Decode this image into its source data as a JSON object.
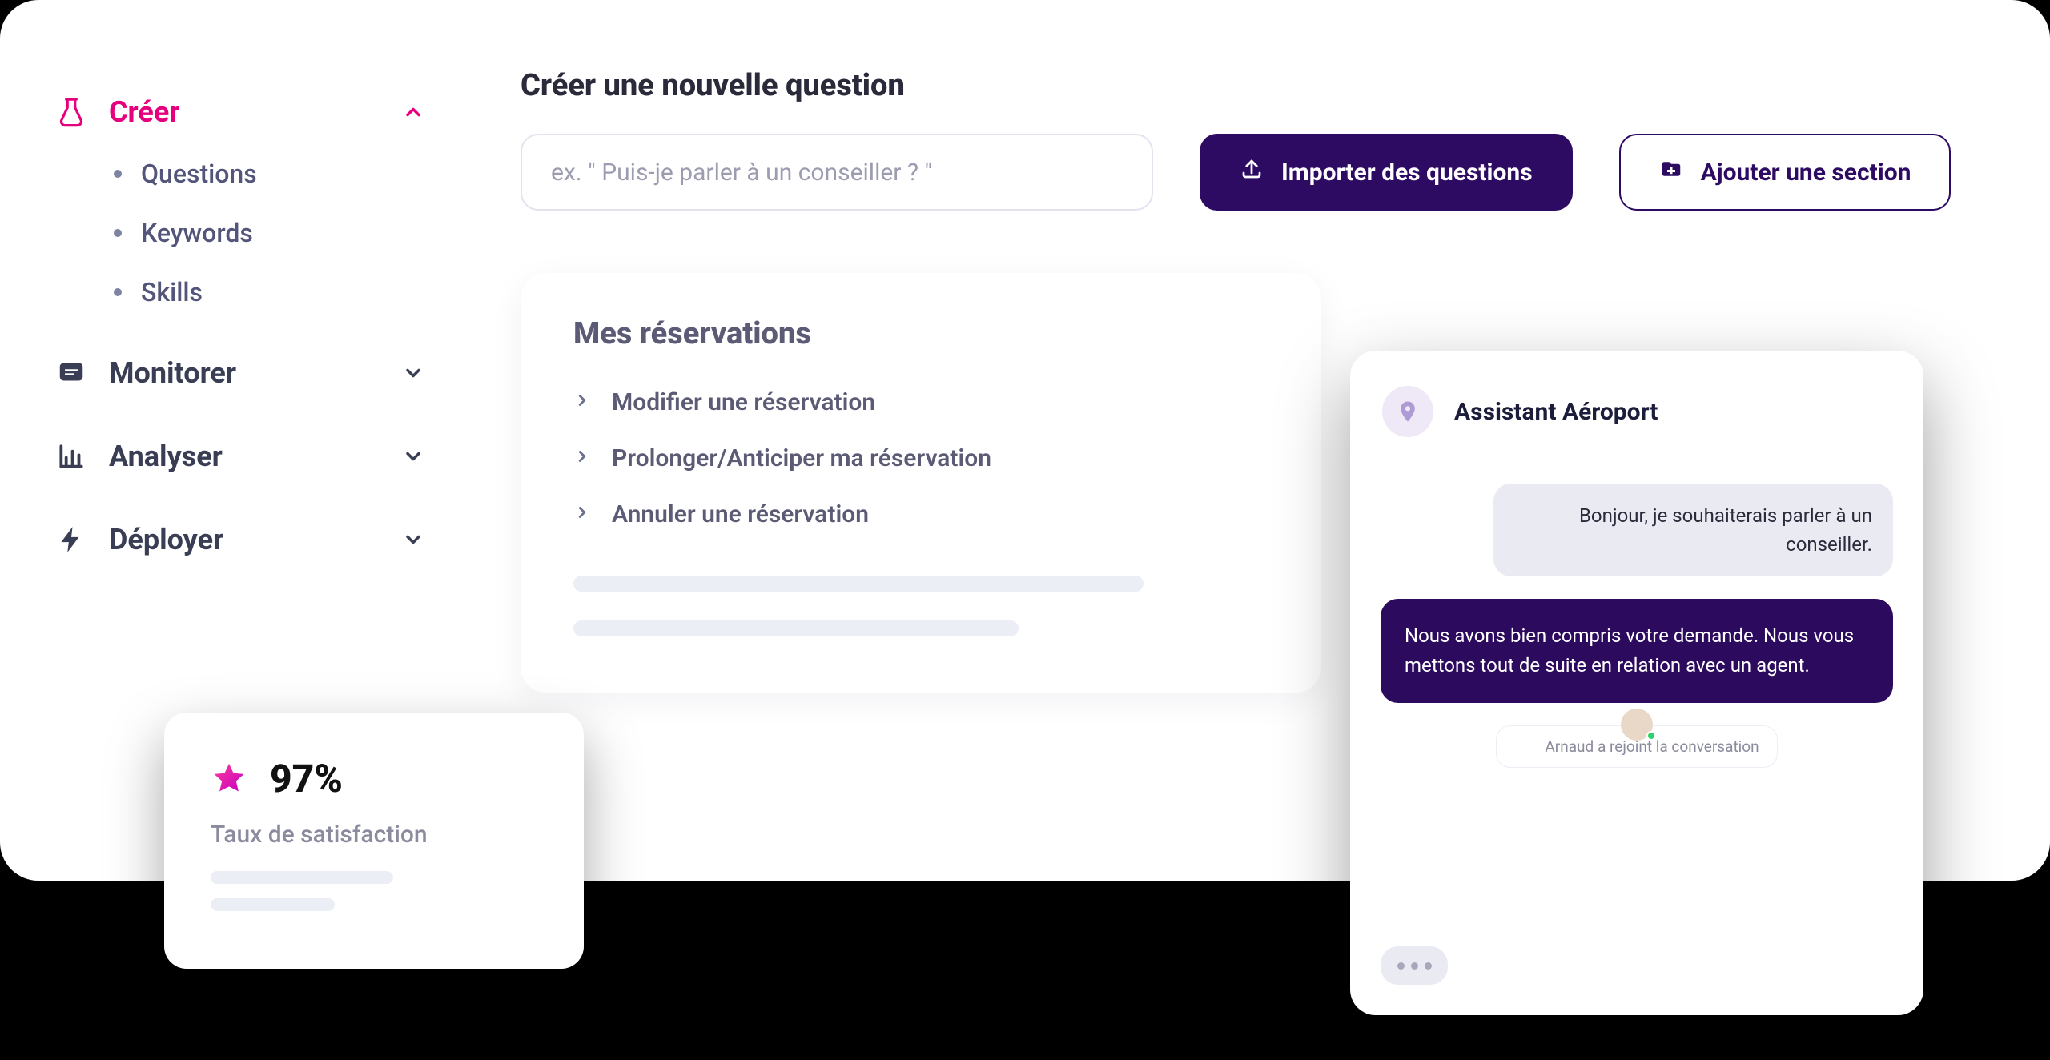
{
  "sidebar": {
    "items": [
      {
        "label": "Créer",
        "active": true,
        "expanded": true
      },
      {
        "label": "Monitorer",
        "active": false
      },
      {
        "label": "Analyser",
        "active": false
      },
      {
        "label": "Déployer",
        "active": false
      }
    ],
    "creer_sub": [
      {
        "label": "Questions"
      },
      {
        "label": "Keywords"
      },
      {
        "label": "Skills"
      }
    ]
  },
  "page": {
    "title": "Créer une nouvelle question",
    "input_placeholder": "ex. \" Puis-je parler à un conseiller ? \"",
    "import_label": "Importer des questions",
    "add_section_label": "Ajouter une section"
  },
  "card": {
    "title": "Mes réservations",
    "rows": [
      {
        "label": "Modifier une réservation"
      },
      {
        "label": "Prolonger/Anticiper ma réservation"
      },
      {
        "label": "Annuler une réservation"
      }
    ]
  },
  "satisfaction": {
    "value": "97%",
    "label": "Taux de satisfaction"
  },
  "chat": {
    "title": "Assistant Aéroport",
    "user_message": "Bonjour, je souhaiterais parler à un conseiller.",
    "bot_message": "Nous avons bien compris votre demande. Nous vous mettons tout de suite en relation avec un agent.",
    "joined_text": "Arnaud a rejoint la conversation"
  },
  "colors": {
    "accent_pink": "#e6007e",
    "accent_purple": "#2d0b63"
  }
}
